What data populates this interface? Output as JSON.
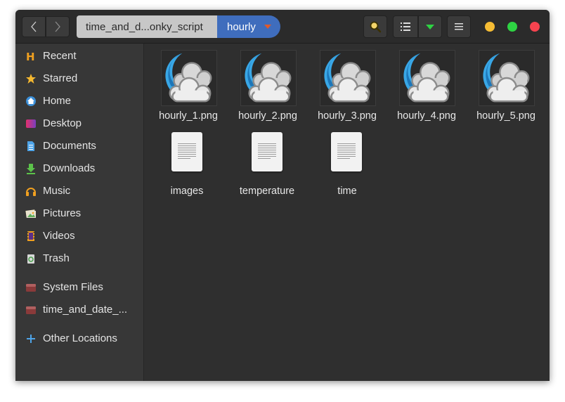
{
  "breadcrumb": {
    "parent_label": "time_and_d...onky_script",
    "current_label": "hourly"
  },
  "sidebar": {
    "items": [
      {
        "label": "Recent",
        "icon": "clock-history-icon"
      },
      {
        "label": "Starred",
        "icon": "star-icon"
      },
      {
        "label": "Home",
        "icon": "home-icon"
      },
      {
        "label": "Desktop",
        "icon": "desktop-icon"
      },
      {
        "label": "Documents",
        "icon": "document-icon"
      },
      {
        "label": "Downloads",
        "icon": "download-icon"
      },
      {
        "label": "Music",
        "icon": "headphones-icon"
      },
      {
        "label": "Pictures",
        "icon": "pictures-icon"
      },
      {
        "label": "Videos",
        "icon": "film-icon"
      },
      {
        "label": "Trash",
        "icon": "trash-icon"
      },
      {
        "label": "System Files",
        "icon": "drive-icon"
      },
      {
        "label": "time_and_date_...",
        "icon": "drive-icon"
      },
      {
        "label": "Other Locations",
        "icon": "plus-icon"
      }
    ]
  },
  "files": [
    {
      "name": "hourly_1.png",
      "type": "image"
    },
    {
      "name": "hourly_2.png",
      "type": "image"
    },
    {
      "name": "hourly_3.png",
      "type": "image"
    },
    {
      "name": "hourly_4.png",
      "type": "image"
    },
    {
      "name": "hourly_5.png",
      "type": "image"
    },
    {
      "name": "images",
      "type": "text"
    },
    {
      "name": "temperature",
      "type": "text"
    },
    {
      "name": "time",
      "type": "text"
    }
  ],
  "colors": {
    "accent": "#3f6dbd",
    "sidebar_bg": "#373737",
    "content_bg": "#2f2f2f",
    "min": "#f5bc34",
    "max": "#2ed343",
    "close": "#f5434f"
  }
}
